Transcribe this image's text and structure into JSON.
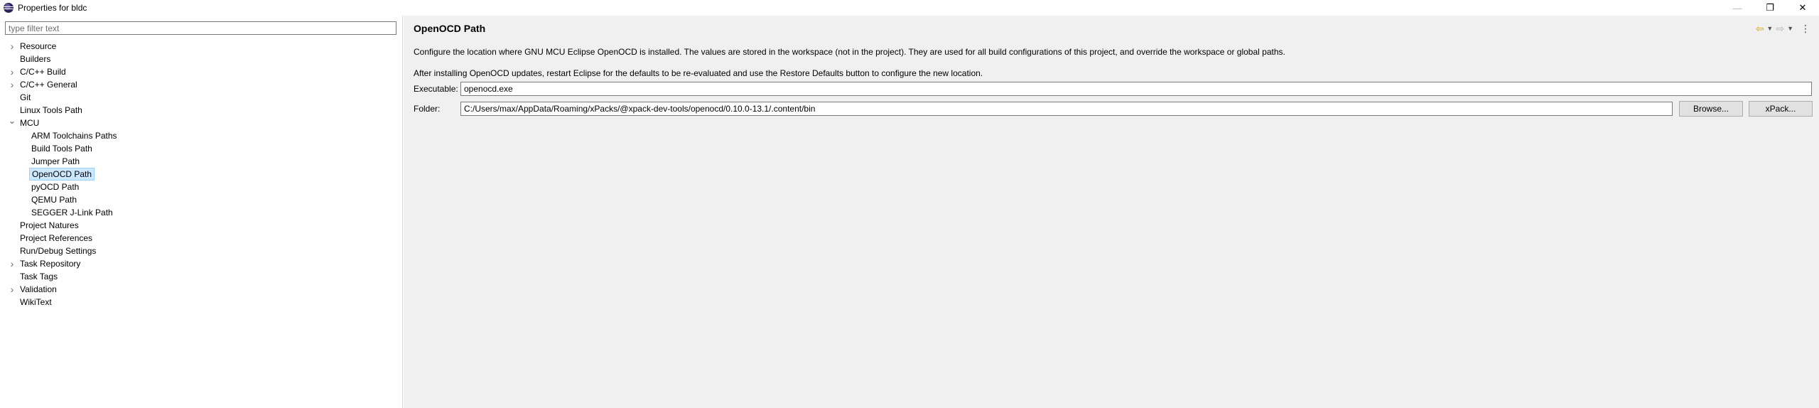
{
  "window": {
    "title": "Properties for bldc",
    "controls": {
      "minimize": "—",
      "restore": "❐",
      "close": "✕"
    }
  },
  "sidebar": {
    "filter_placeholder": "type filter text",
    "items": [
      {
        "label": "Resource",
        "expandable": true,
        "level": 0
      },
      {
        "label": "Builders",
        "expandable": false,
        "level": 0
      },
      {
        "label": "C/C++ Build",
        "expandable": true,
        "level": 0
      },
      {
        "label": "C/C++ General",
        "expandable": true,
        "level": 0
      },
      {
        "label": "Git",
        "expandable": false,
        "level": 0
      },
      {
        "label": "Linux Tools Path",
        "expandable": false,
        "level": 0
      },
      {
        "label": "MCU",
        "expandable": true,
        "expanded": true,
        "level": 0
      },
      {
        "label": "ARM Toolchains Paths",
        "level": 1
      },
      {
        "label": "Build Tools Path",
        "level": 1
      },
      {
        "label": "Jumper Path",
        "level": 1
      },
      {
        "label": "OpenOCD Path",
        "level": 1,
        "selected": true
      },
      {
        "label": "pyOCD Path",
        "level": 1
      },
      {
        "label": "QEMU Path",
        "level": 1
      },
      {
        "label": "SEGGER J-Link Path",
        "level": 1
      },
      {
        "label": "Project Natures",
        "expandable": false,
        "level": 0
      },
      {
        "label": "Project References",
        "expandable": false,
        "level": 0
      },
      {
        "label": "Run/Debug Settings",
        "expandable": false,
        "level": 0
      },
      {
        "label": "Task Repository",
        "expandable": true,
        "level": 0
      },
      {
        "label": "Task Tags",
        "expandable": false,
        "level": 0
      },
      {
        "label": "Validation",
        "expandable": true,
        "level": 0
      },
      {
        "label": "WikiText",
        "expandable": false,
        "level": 0
      }
    ]
  },
  "main": {
    "title": "OpenOCD Path",
    "description": "Configure the location where GNU MCU Eclipse OpenOCD is installed. The values are stored in the workspace (not in the project). They are used for all build configurations of this project, and override the workspace or global paths.",
    "note": "After installing OpenOCD updates, restart Eclipse for the defaults to be re-evaluated and use the Restore Defaults button to configure the new location.",
    "executable": {
      "label": "Executable:",
      "value": "openocd.exe"
    },
    "folder": {
      "label": "Folder:",
      "value": "C:/Users/max/AppData/Roaming/xPacks/@xpack-dev-tools/openocd/0.10.0-13.1/.content/bin"
    },
    "browse_label": "Browse...",
    "xpack_label": "xPack...",
    "nav": {
      "back_icon": "⇦",
      "forward_icon": "⇨",
      "dropdown_icon": "▼",
      "menu_icon": "⋮"
    }
  },
  "colors": {
    "accent_selection": "#cce8ff",
    "back_arrow": "#d9a21b"
  }
}
